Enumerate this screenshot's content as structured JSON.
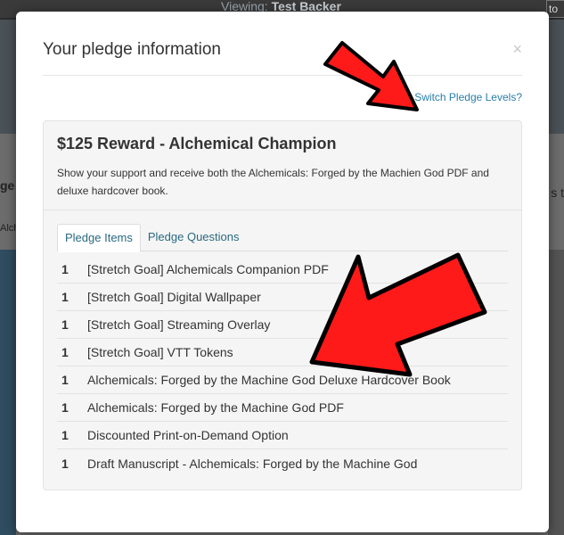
{
  "background": {
    "viewing_label": "Viewing:",
    "viewing_user": "Test Backer",
    "topright_text": "to",
    "left_text": "ge",
    "left_text_small": "Alch",
    "right_text": "s t"
  },
  "modal": {
    "title": "Your pledge information",
    "close_label": "×",
    "switch_label": "Switch Pledge Levels?"
  },
  "reward": {
    "title": "$125 Reward - Alchemical Champion",
    "description": "Show your support and receive both the Alchemicals: Forged by the Machien God PDF and deluxe hardcover book."
  },
  "tabs": [
    {
      "label": "Pledge Items",
      "active": true
    },
    {
      "label": "Pledge Questions",
      "active": false
    }
  ],
  "pledge_items": [
    {
      "qty": "1",
      "name": "[Stretch Goal] Alchemicals Companion PDF"
    },
    {
      "qty": "1",
      "name": "[Stretch Goal] Digital Wallpaper"
    },
    {
      "qty": "1",
      "name": "[Stretch Goal] Streaming Overlay"
    },
    {
      "qty": "1",
      "name": "[Stretch Goal] VTT Tokens"
    },
    {
      "qty": "1",
      "name": "Alchemicals: Forged by the Machine God Deluxe Hardcover Book"
    },
    {
      "qty": "1",
      "name": "Alchemicals: Forged by the Machine God PDF"
    },
    {
      "qty": "1",
      "name": "Discounted Print-on-Demand Option"
    },
    {
      "qty": "1",
      "name": "Draft Manuscript - Alchemicals: Forged by the Machine God"
    }
  ],
  "colors": {
    "link": "#2a7fa8",
    "arrow_fill": "#ff1a1a",
    "arrow_outline": "#000000"
  }
}
